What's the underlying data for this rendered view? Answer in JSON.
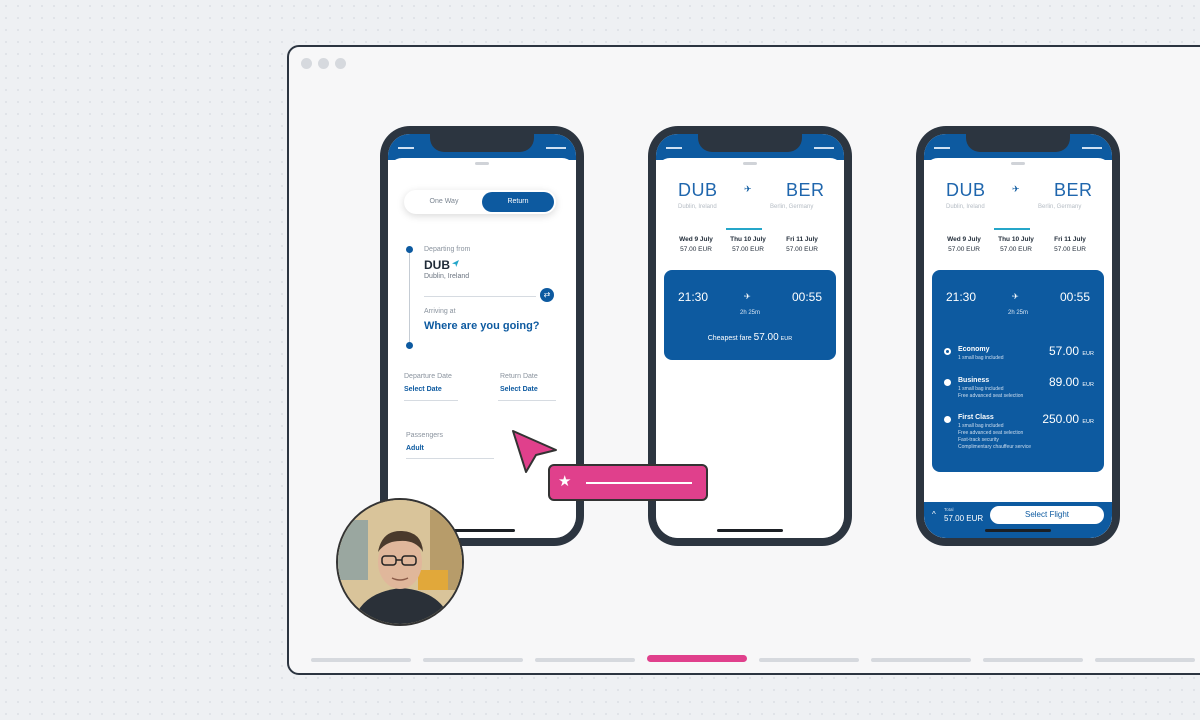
{
  "phone1": {
    "toggle": {
      "one_way": "One Way",
      "return": "Return"
    },
    "departing_label": "Departing from",
    "departing_code": "DUB",
    "departing_city": "Dublin, Ireland",
    "arriving_label": "Arriving at",
    "arriving_value": "Where are you going?",
    "departure_date_label": "Departure Date",
    "departure_date_value": "Select Date",
    "return_date_label": "Return Date",
    "return_date_value": "Select Date",
    "passengers_label": "Passengers",
    "passengers_value": "Adult"
  },
  "phone2": {
    "from_code": "DUB",
    "from_city": "Dublin, Ireland",
    "to_code": "BER",
    "to_city": "Berlin, Germany",
    "dates": [
      {
        "day": "Wed 9 July",
        "price": "57.00 EUR"
      },
      {
        "day": "Thu 10 July",
        "price": "57.00 EUR"
      },
      {
        "day": "Fri 11 July",
        "price": "57.00 EUR"
      }
    ],
    "depart_time": "21:30",
    "arrive_time": "00:55",
    "duration": "2h 25m",
    "cheapest_label": "Cheapest fare",
    "cheapest_price": "57.00",
    "currency": "EUR"
  },
  "phone3": {
    "from_code": "DUB",
    "from_city": "Dublin, Ireland",
    "to_code": "BER",
    "to_city": "Berlin, Germany",
    "dates": [
      {
        "day": "Wed 9 July",
        "price": "57.00 EUR"
      },
      {
        "day": "Thu 10 July",
        "price": "57.00 EUR"
      },
      {
        "day": "Fri 11 July",
        "price": "57.00 EUR"
      }
    ],
    "depart_time": "21:30",
    "arrive_time": "00:55",
    "duration": "2h 25m",
    "options": [
      {
        "name": "Economy",
        "desc": [
          "1 small bag included"
        ],
        "price": "57.00",
        "currency": "EUR",
        "selected": true
      },
      {
        "name": "Business",
        "desc": [
          "1 small bag included",
          "Free advanced seat selection"
        ],
        "price": "89.00",
        "currency": "EUR",
        "selected": false
      },
      {
        "name": "First Class",
        "desc": [
          "1 small bag included",
          "Free advanced seat selection",
          "Fast-track security",
          "Complimentary chauffeur service"
        ],
        "price": "250.00",
        "currency": "EUR",
        "selected": false
      }
    ],
    "total_label": "Total",
    "total_value": "57.00 EUR",
    "select_button": "Select Flight"
  },
  "colors": {
    "brand_blue": "#0d5aa0",
    "accent_pink": "#e0408c",
    "frame": "#2c3540"
  },
  "icons": [
    "plane-icon",
    "swap-icon",
    "star-icon",
    "cursor-icon",
    "chevron-up-icon"
  ]
}
